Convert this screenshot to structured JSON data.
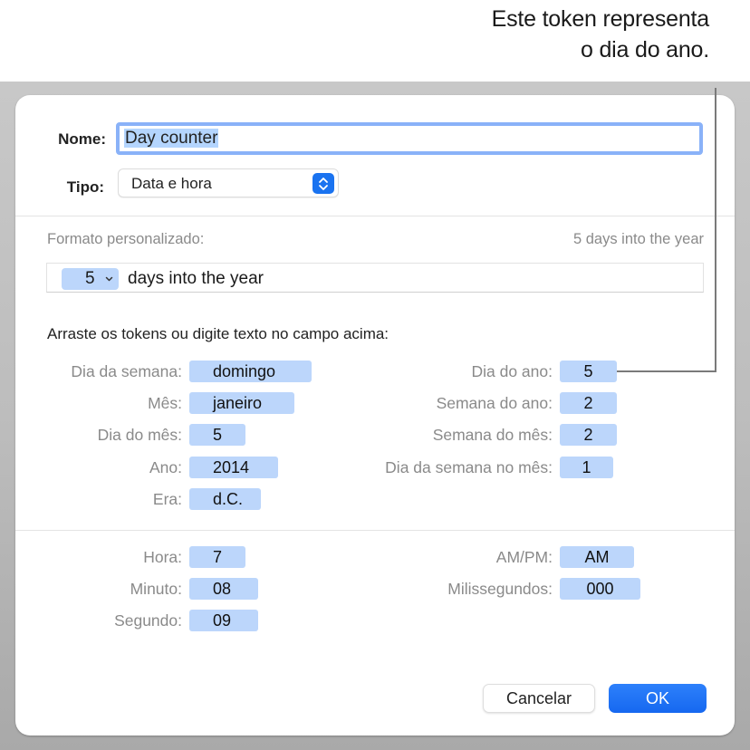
{
  "callout": {
    "line1": "Este token representa",
    "line2": "o dia do ano."
  },
  "dialog": {
    "name_label": "Nome:",
    "name_value": "Day counter",
    "type_label": "Tipo:",
    "type_value": "Data e hora",
    "custom_format_label": "Formato personalizado:",
    "custom_format_preview": "5 days into the year",
    "format_field": {
      "token_value": "5",
      "text": "days into the year"
    },
    "instructions": "Arraste os tokens ou digite texto no campo acima:",
    "date_tokens_left": [
      {
        "label": "Dia da semana:",
        "value": "domingo"
      },
      {
        "label": "Mês:",
        "value": "janeiro"
      },
      {
        "label": "Dia do mês:",
        "value": "5"
      },
      {
        "label": "Ano:",
        "value": "2014"
      },
      {
        "label": "Era:",
        "value": "d.C."
      }
    ],
    "date_tokens_right": [
      {
        "label": "Dia do ano:",
        "value": "5"
      },
      {
        "label": "Semana do ano:",
        "value": "2"
      },
      {
        "label": "Semana do mês:",
        "value": "2"
      },
      {
        "label": "Dia da semana no mês:",
        "value": "1"
      }
    ],
    "time_tokens_left": [
      {
        "label": "Hora:",
        "value": "7"
      },
      {
        "label": "Minuto:",
        "value": "08"
      },
      {
        "label": "Segundo:",
        "value": "09"
      }
    ],
    "time_tokens_right": [
      {
        "label": "AM/PM:",
        "value": "AM"
      },
      {
        "label": "Milissegundos:",
        "value": "000"
      }
    ],
    "cancel_label": "Cancelar",
    "ok_label": "OK"
  }
}
